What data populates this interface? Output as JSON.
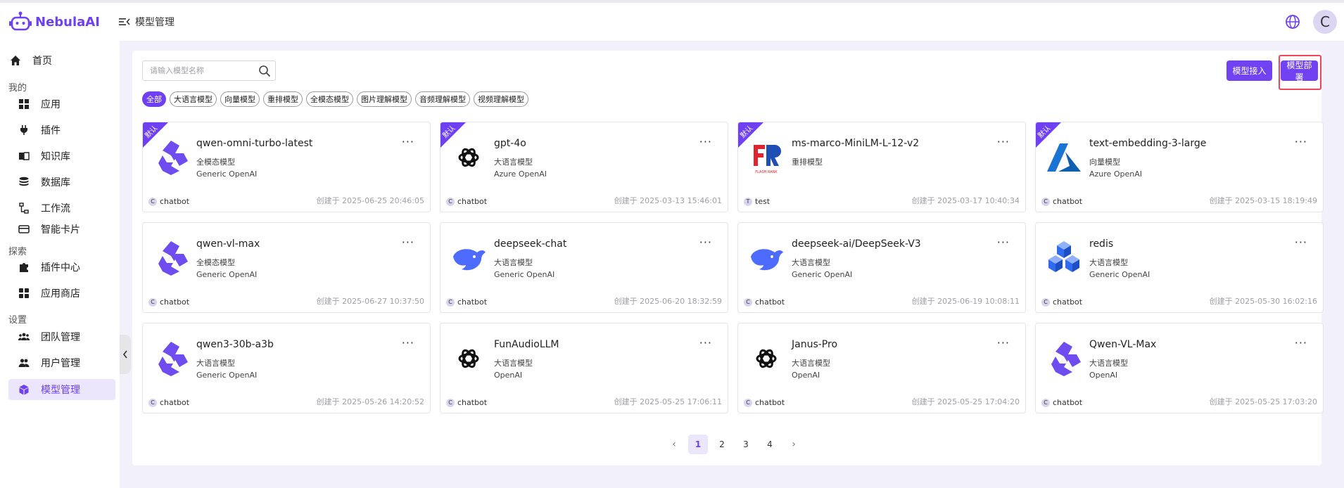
{
  "app": {
    "name": "NebulaAI",
    "brand_color": "#6e3ff3"
  },
  "header": {
    "page_label": "模型管理",
    "avatar_initial": "C"
  },
  "sidebar": {
    "home": "首页",
    "sections": [
      {
        "label": "我的",
        "items": [
          "应用",
          "插件",
          "知识库",
          "数据库",
          "工作流",
          "智能卡片"
        ]
      },
      {
        "label": "探索",
        "items": [
          "插件中心",
          "应用商店"
        ]
      },
      {
        "label": "设置",
        "items": [
          "团队管理",
          "用户管理",
          "模型管理"
        ]
      }
    ],
    "active_item": "模型管理"
  },
  "search": {
    "placeholder": "请输入模型名称",
    "value": ""
  },
  "toolbar": {
    "import_label": "模型接入",
    "deploy_label": "模型部署"
  },
  "filters": [
    "全部",
    "大语言模型",
    "向量模型",
    "重排模型",
    "全模态模型",
    "图片理解模型",
    "音频理解模型",
    "视频理解模型"
  ],
  "active_filter": "全部",
  "default_badge": "默认",
  "more_label": "···",
  "cards": [
    {
      "name": "qwen-omni-turbo-latest",
      "type": "全模态模型",
      "provider": "Generic OpenAI",
      "owner": "chatbot",
      "owner_initial": "C",
      "created": "创建于 2025-06-25 20:46:05",
      "default": true,
      "icon": "qwen-icon"
    },
    {
      "name": "gpt-4o",
      "type": "大语言模型",
      "provider": "Azure OpenAI",
      "owner": "chatbot",
      "owner_initial": "C",
      "created": "创建于 2025-03-13 15:46:01",
      "default": true,
      "icon": "openai-icon"
    },
    {
      "name": "ms-marco-MiniLM-L-12-v2",
      "type": "重排模型",
      "provider": "",
      "owner": "test",
      "owner_initial": "T",
      "created": "创建于 2025-03-17 10:40:34",
      "default": true,
      "icon": "flashrank-icon"
    },
    {
      "name": "text-embedding-3-large",
      "type": "向量模型",
      "provider": "Azure OpenAI",
      "owner": "chatbot",
      "owner_initial": "C",
      "created": "创建于 2025-03-15 18:19:49",
      "default": true,
      "icon": "azure-icon"
    },
    {
      "name": "qwen-vl-max",
      "type": "全模态模型",
      "provider": "Generic OpenAI",
      "owner": "chatbot",
      "owner_initial": "C",
      "created": "创建于 2025-06-27 10:37:50",
      "default": false,
      "icon": "qwen-icon"
    },
    {
      "name": "deepseek-chat",
      "type": "大语言模型",
      "provider": "Generic OpenAI",
      "owner": "chatbot",
      "owner_initial": "C",
      "created": "创建于 2025-06-20 18:32:59",
      "default": false,
      "icon": "deepseek-icon"
    },
    {
      "name": "deepseek-ai/DeepSeek-V3",
      "type": "大语言模型",
      "provider": "Generic OpenAI",
      "owner": "chatbot",
      "owner_initial": "C",
      "created": "创建于 2025-06-19 10:08:11",
      "default": false,
      "icon": "deepseek-icon"
    },
    {
      "name": "redis",
      "type": "大语言模型",
      "provider": "Generic OpenAI",
      "owner": "chatbot",
      "owner_initial": "C",
      "created": "创建于 2025-05-30 16:02:16",
      "default": false,
      "icon": "cubes-icon"
    },
    {
      "name": "qwen3-30b-a3b",
      "type": "大语言模型",
      "provider": "Generic OpenAI",
      "owner": "chatbot",
      "owner_initial": "C",
      "created": "创建于 2025-05-26 14:20:52",
      "default": false,
      "icon": "qwen-icon"
    },
    {
      "name": "FunAudioLLM",
      "type": "大语言模型",
      "provider": "OpenAI",
      "owner": "chatbot",
      "owner_initial": "C",
      "created": "创建于 2025-05-25 17:06:11",
      "default": false,
      "icon": "openai-icon"
    },
    {
      "name": "Janus-Pro",
      "type": "大语言模型",
      "provider": "OpenAI",
      "owner": "chatbot",
      "owner_initial": "C",
      "created": "创建于 2025-05-25 17:04:20",
      "default": false,
      "icon": "openai-icon"
    },
    {
      "name": "Qwen-VL-Max",
      "type": "大语言模型",
      "provider": "OpenAI",
      "owner": "chatbot",
      "owner_initial": "C",
      "created": "创建于 2025-05-25 17:03:20",
      "default": false,
      "icon": "qwen-icon"
    }
  ],
  "pagination": {
    "pages": [
      "1",
      "2",
      "3",
      "4"
    ],
    "current": "1",
    "prev": "‹",
    "next": "›"
  }
}
